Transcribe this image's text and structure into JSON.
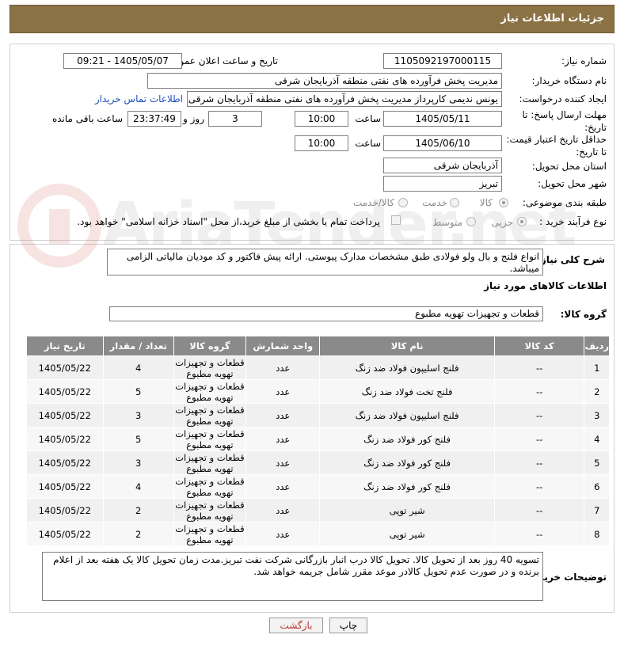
{
  "header": {
    "title": "جزئیات اطلاعات نیاز"
  },
  "form": {
    "need_number_label": "شماره نیاز:",
    "need_number": "1105092197000115",
    "announce_label": "تاریخ و ساعت اعلان عمومی:",
    "announce_value": "1405/05/07 - 09:21",
    "buyer_label": "نام دستگاه خریدار:",
    "buyer_value": "مدیریت پخش فرآورده های نفتی منطقه آذربایجان شرقی",
    "creator_label": "ایجاد کننده درخواست:",
    "creator_value": "یونس ندیمی کارپرداز مدیریت پخش فرآورده های نفتی منطقه آذربایجان شرقی",
    "contact_link": "اطلاعات تماس خریدار",
    "deadline_label_1": "مهلت ارسال پاسخ: تا",
    "deadline_label_2": "تاریخ:",
    "deadline_date": "1405/05/11",
    "time_label": "ساعت",
    "deadline_time": "10:00",
    "days_value": "3",
    "days_label": "روز و",
    "remaining_time": "23:37:49",
    "remaining_label": "ساعت باقی مانده",
    "min_validity_label_1": "حداقل تاریخ اعتبار قیمت:",
    "min_validity_label_2": "تا تاریخ:",
    "validity_date": "1405/06/10",
    "validity_time": "10:00",
    "province_label": "استان محل تحویل:",
    "province_value": "آذربایجان شرقی",
    "city_label": "شهر محل تحویل:",
    "city_value": "تبریز",
    "category_label": "طبقه بندی موضوعی:",
    "category_options": [
      "کالا",
      "خدمت",
      "کالا/خدمت"
    ],
    "process_label": "نوع فرآیند خرید :",
    "process_options": [
      "جزیی",
      "متوسط"
    ],
    "payment_note": "پرداخت تمام یا بخشی از مبلغ خرید،از محل \"اسناد خزانه اسلامی\" خواهد بود."
  },
  "description": {
    "label": "شرح کلی نیاز:",
    "text": "انواع فلنج و بال ولو فولادی طبق مشخصات مدارک پیوستی. ارائه پیش فاکتور و کد مودیان مالیاتی الزامی میباشد."
  },
  "goods": {
    "section_title": "اطلاعات کالاهای مورد نیاز",
    "group_label": "گروه کالا:",
    "group_value": "قطعات و تجهیزات تهویه مطبوع",
    "columns": [
      "ردیف",
      "کد کالا",
      "نام کالا",
      "واحد شمارش",
      "گروه کالا",
      "تعداد / مقدار",
      "تاریخ نیاز"
    ],
    "rows": [
      {
        "no": "1",
        "code": "--",
        "name": "فلنج اسلیپون فولاد ضد زنگ",
        "unit": "عدد",
        "group": "قطعات و تجهیزات تهویه مطبوع",
        "qty": "4",
        "date": "1405/05/22"
      },
      {
        "no": "2",
        "code": "--",
        "name": "فلنج تخت فولاد ضد زنگ",
        "unit": "عدد",
        "group": "قطعات و تجهیزات تهویه مطبوع",
        "qty": "5",
        "date": "1405/05/22"
      },
      {
        "no": "3",
        "code": "--",
        "name": "فلنج اسلیپون فولاد ضد زنگ",
        "unit": "عدد",
        "group": "قطعات و تجهیزات تهویه مطبوع",
        "qty": "3",
        "date": "1405/05/22"
      },
      {
        "no": "4",
        "code": "--",
        "name": "فلنج کور فولاد ضد زنگ",
        "unit": "عدد",
        "group": "قطعات و تجهیزات تهویه مطبوع",
        "qty": "5",
        "date": "1405/05/22"
      },
      {
        "no": "5",
        "code": "--",
        "name": "فلنج کور فولاد ضد زنگ",
        "unit": "عدد",
        "group": "قطعات و تجهیزات تهویه مطبوع",
        "qty": "3",
        "date": "1405/05/22"
      },
      {
        "no": "6",
        "code": "--",
        "name": "فلنج کور فولاد ضد زنگ",
        "unit": "عدد",
        "group": "قطعات و تجهیزات تهویه مطبوع",
        "qty": "4",
        "date": "1405/05/22"
      },
      {
        "no": "7",
        "code": "--",
        "name": "شیر توپی",
        "unit": "عدد",
        "group": "قطعات و تجهیزات تهویه مطبوع",
        "qty": "2",
        "date": "1405/05/22"
      },
      {
        "no": "8",
        "code": "--",
        "name": "شیر توپی",
        "unit": "عدد",
        "group": "قطعات و تجهیزات تهویه مطبوع",
        "qty": "2",
        "date": "1405/05/22"
      }
    ]
  },
  "buyer_notes": {
    "label": "توضیحات خریدار:",
    "text": "تسویه 40 روز بعد از تحویل کالا. تحویل کالا درب انبار بازرگانی شرکت نفت تبریز.مدت زمان تحویل کالا یک هفته بعد از اعلام برنده و در صورت عدم تحویل کالادر موعد مقرر شامل جریمه خواهد شد."
  },
  "buttons": {
    "print": "چاپ",
    "back": "بازگشت"
  },
  "watermark": {
    "text": "AriaTender.net",
    "logo_color": "#cc3333"
  }
}
